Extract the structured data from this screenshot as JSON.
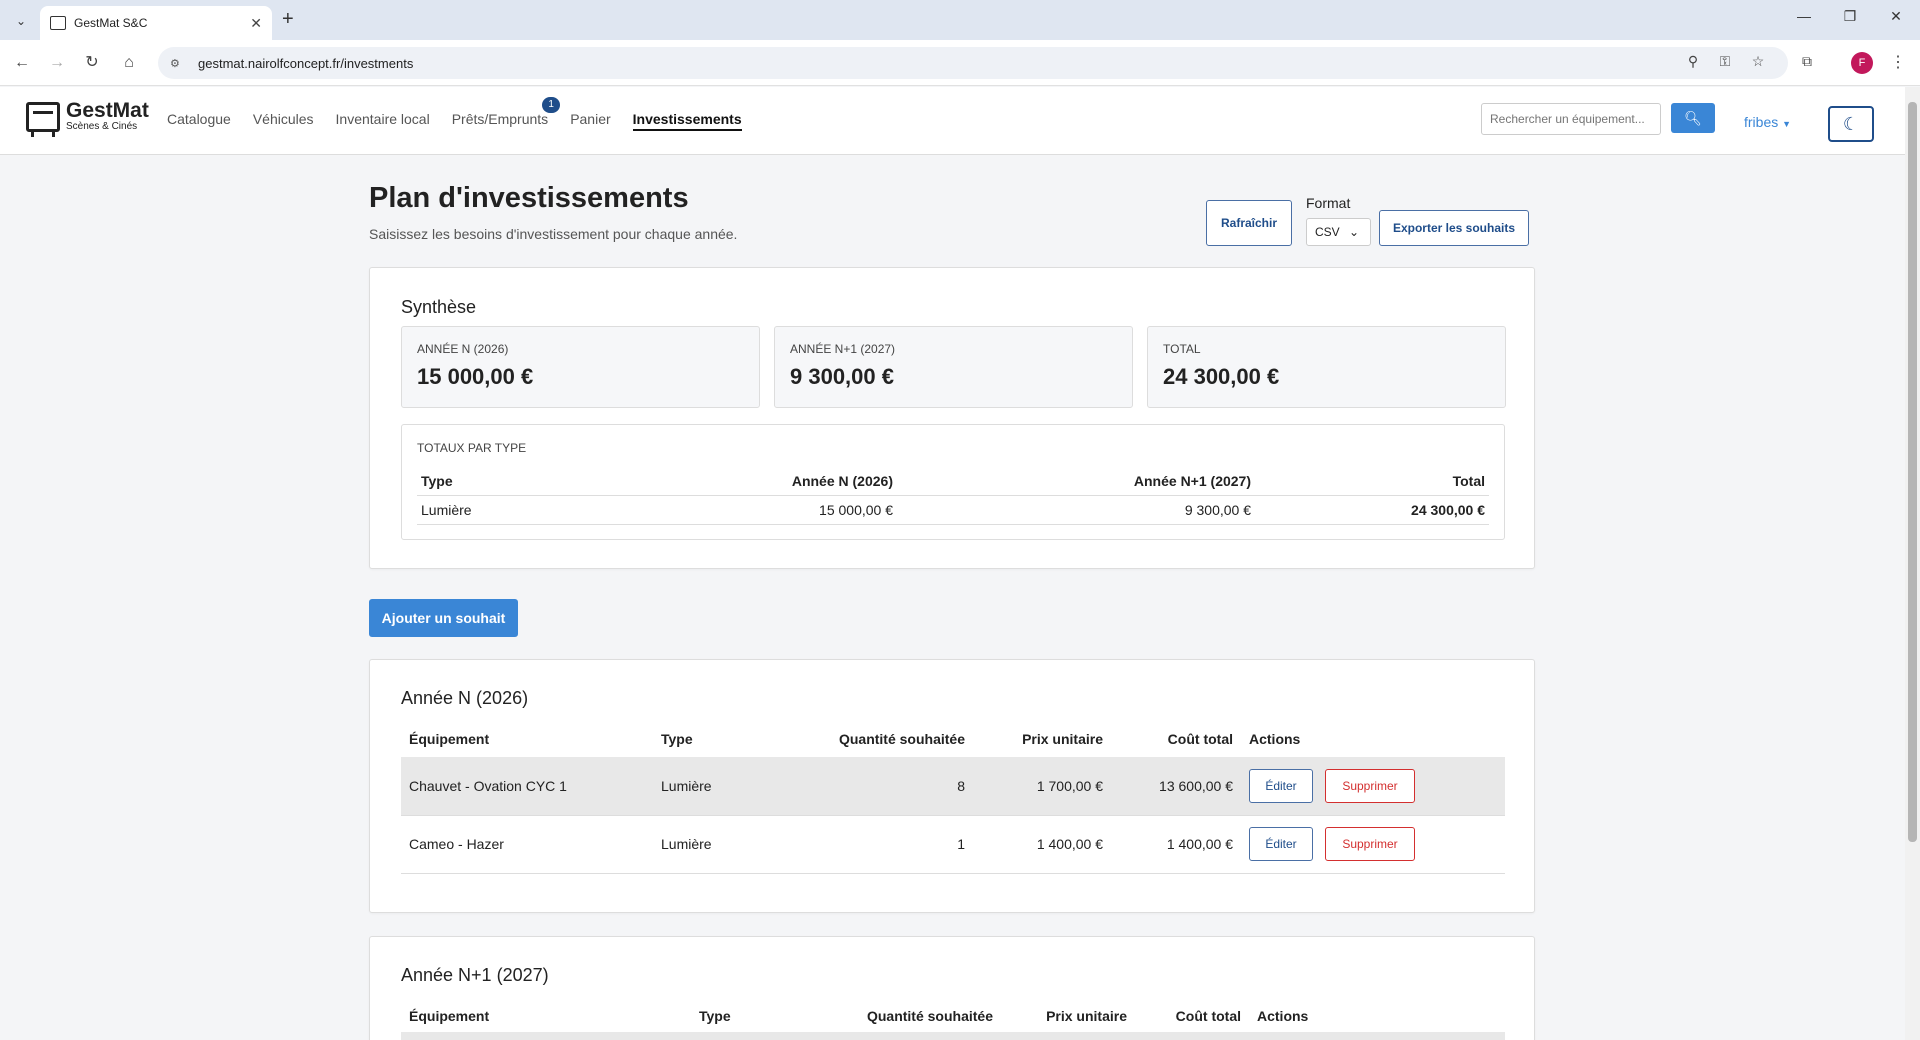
{
  "browser": {
    "tab_title": "GestMat S&C",
    "url": "gestmat.nairolfconcept.fr/investments",
    "profile_initial": "F"
  },
  "nav": {
    "logo_title": "GestMat",
    "logo_subtitle": "Scènes & Cinés",
    "links": [
      "Catalogue",
      "Véhicules",
      "Inventaire local",
      "Prêts/Emprunts",
      "Panier",
      "Investissements"
    ],
    "loans_badge": "1",
    "search_placeholder": "Rechercher un équipement...",
    "user": "fribes"
  },
  "page": {
    "title": "Plan d'investissements",
    "subtitle": "Saisissez les besoins d'investissement pour chaque année.",
    "refresh_label": "Rafraîchir",
    "format_label": "Format",
    "format_value": "CSV",
    "export_label": "Exporter les souhaits",
    "add_label": "Ajouter un souhait"
  },
  "summary": {
    "title": "Synthèse",
    "stats": [
      {
        "label": "ANNÉE N (2026)",
        "value": "15 000,00 €"
      },
      {
        "label": "ANNÉE N+1 (2027)",
        "value": "9 300,00 €"
      },
      {
        "label": "TOTAL",
        "value": "24 300,00 €"
      }
    ],
    "types_label": "TOTAUX PAR TYPE",
    "types_headers": [
      "Type",
      "Année N (2026)",
      "Année N+1 (2027)",
      "Total"
    ],
    "types_rows": [
      {
        "type": "Lumière",
        "n": "15 000,00 €",
        "n1": "9 300,00 €",
        "total": "24 300,00 €"
      }
    ]
  },
  "year_n": {
    "title": "Année N (2026)",
    "headers": [
      "Équipement",
      "Type",
      "Quantité souhaitée",
      "Prix unitaire",
      "Coût total",
      "Actions"
    ],
    "rows": [
      {
        "equipment": "Chauvet - Ovation CYC 1",
        "type": "Lumière",
        "qty": "8",
        "unit": "1 700,00 €",
        "total": "13 600,00 €"
      },
      {
        "equipment": "Cameo - Hazer",
        "type": "Lumière",
        "qty": "1",
        "unit": "1 400,00 €",
        "total": "1 400,00 €"
      }
    ],
    "edit_label": "Éditer",
    "delete_label": "Supprimer"
  },
  "year_n1": {
    "title": "Année N+1 (2027)",
    "headers": [
      "Équipement",
      "Type",
      "Quantité souhaitée",
      "Prix unitaire",
      "Coût total",
      "Actions"
    ]
  }
}
